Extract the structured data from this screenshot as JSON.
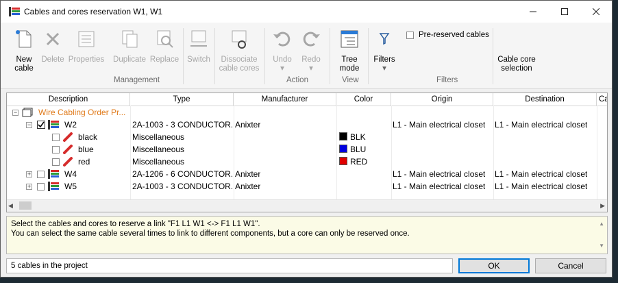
{
  "window": {
    "title": "Cables and cores reservation W1, W1"
  },
  "ribbon": {
    "new_cable": "New cable",
    "delete": "Delete",
    "properties": "Properties",
    "group_management": "Management",
    "duplicate": "Duplicate",
    "replace": "Replace",
    "switch": "Switch",
    "dissociate": "Dissociate cable cores",
    "undo": "Undo",
    "redo": "Redo",
    "group_action": "Action",
    "tree_mode": "Tree mode",
    "group_view": "View",
    "filters_button": "Filters",
    "pre_reserved": "Pre-reserved cables",
    "group_filters": "Filters",
    "cable_core_selection": "Cable core selection"
  },
  "grid": {
    "columns": [
      "Description",
      "Type",
      "Manufacturer",
      "Color",
      "Origin",
      "Destination",
      "Ca"
    ],
    "root": "Wire Cabling Order Pr...",
    "rows": [
      {
        "desc": "W2",
        "type": "2A-1003 - 3 CONDUCTOR...",
        "manufacturer": "Anixter",
        "color": "",
        "origin": "L1 - Main electrical closet",
        "destination": "L1 - Main electrical closet"
      },
      {
        "desc": "black",
        "type": "Miscellaneous",
        "manufacturer": "",
        "color": "BLK",
        "origin": "",
        "destination": ""
      },
      {
        "desc": "blue",
        "type": "Miscellaneous",
        "manufacturer": "",
        "color": "BLU",
        "origin": "",
        "destination": ""
      },
      {
        "desc": "red",
        "type": "Miscellaneous",
        "manufacturer": "",
        "color": "RED",
        "origin": "",
        "destination": ""
      },
      {
        "desc": "W4",
        "type": "2A-1206 - 6 CONDUCTOR...",
        "manufacturer": "Anixter",
        "color": "",
        "origin": "L1 - Main electrical closet",
        "destination": "L1 - Main electrical closet"
      },
      {
        "desc": "W5",
        "type": "2A-1003 - 3 CONDUCTOR...",
        "manufacturer": "Anixter",
        "color": "",
        "origin": "L1 - Main electrical closet",
        "destination": "L1 - Main electrical closet"
      }
    ],
    "swatch_colors": {
      "BLK": "#000000",
      "BLU": "#0000e0",
      "RED": "#e00000"
    }
  },
  "message": {
    "line1": "Select the cables and cores to reserve a link \"F1 L1 W1 <-> F1 L1 W1\".",
    "line2": "You can select the same cable several times to link to different components, but a core can only be reserved once."
  },
  "status": {
    "text": "5 cables in the project"
  },
  "buttons": {
    "ok": "OK",
    "cancel": "Cancel"
  }
}
